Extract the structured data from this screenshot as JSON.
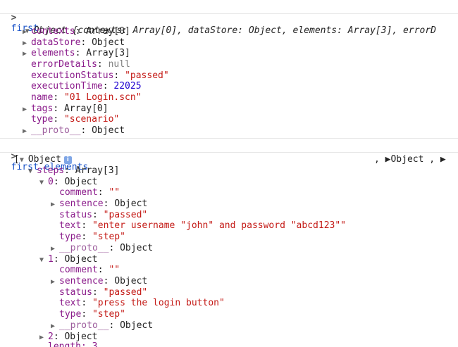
{
  "entries": {
    "cmd1": "first",
    "cmd2": "first.elements"
  },
  "obj1": {
    "summary_label": "Object",
    "summary_tail": " {contexts: Array[0], dataStore: Object, elements: Array[3], errorD",
    "rows": [
      {
        "key": "contexts",
        "value": "Array[0]"
      },
      {
        "key": "dataStore",
        "value": "Object"
      },
      {
        "key": "elements",
        "value": "Array[3]"
      },
      {
        "key": "errorDetails",
        "value": "null"
      },
      {
        "key": "executionStatus",
        "value": "\"passed\""
      },
      {
        "key": "executionTime",
        "value": "22025"
      },
      {
        "key": "name",
        "value": "\"01 Login.scn\""
      },
      {
        "key": "tags",
        "value": "Array[0]"
      },
      {
        "key": "type",
        "value": "\"scenario\""
      },
      {
        "key": "__proto__",
        "value": "Object"
      }
    ]
  },
  "arr": {
    "open": "[",
    "label": "Object",
    "info": "i",
    "right_tail": ", ▶Object , ▶",
    "steps_key": "steps",
    "steps_value": "Array[3]",
    "step0": {
      "key": "0",
      "value": "Object",
      "comment": "\"\"",
      "sentence": "Object",
      "status": "\"passed\"",
      "text": "\"enter username \"john\" and password \"abcd123\"\"",
      "type": "\"step\"",
      "proto": "Object"
    },
    "step1": {
      "key": "1",
      "value": "Object",
      "comment": "\"\"",
      "sentence": "Object",
      "status": "\"passed\"",
      "text": "\"press the login button\"",
      "type": "\"step\"",
      "proto": "Object"
    },
    "step2": {
      "key": "2",
      "value": "Object"
    },
    "length_partial": "length: 3"
  },
  "labels": {
    "comment": "comment",
    "sentence": "sentence",
    "status": "status",
    "text": "text",
    "type": "type",
    "proto": "__proto__"
  }
}
